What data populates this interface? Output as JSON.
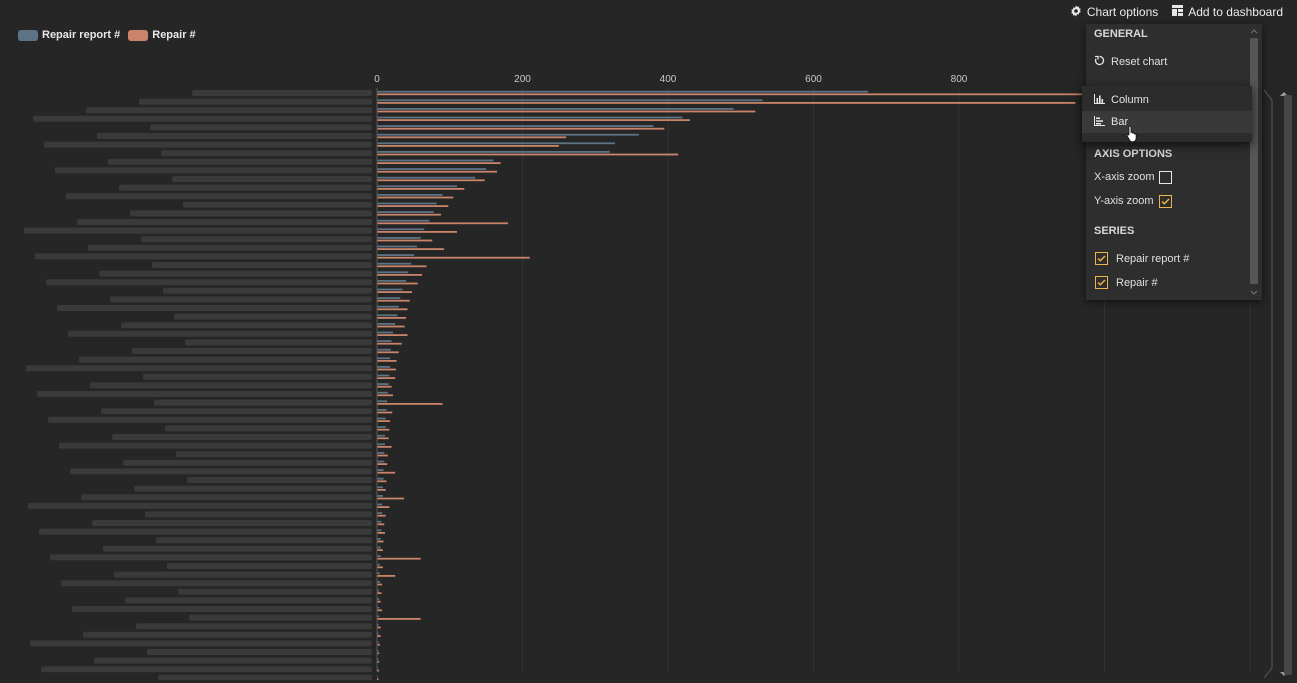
{
  "legend": {
    "items": [
      {
        "label": "Repair report #",
        "color": "#5f7387"
      },
      {
        "label": "Repair #",
        "color": "#c98469"
      }
    ]
  },
  "toolbar": {
    "chart_options_label": "Chart options",
    "add_to_dashboard_label": "Add to dashboard"
  },
  "menu": {
    "general_title": "GENERAL",
    "reset_label": "Reset chart",
    "chart_types": [
      {
        "label": "Column",
        "selected": false
      },
      {
        "label": "Bar",
        "selected": true
      }
    ],
    "axis_title": "AXIS OPTIONS",
    "x_zoom_label": "X-axis zoom",
    "x_zoom_checked": false,
    "y_zoom_label": "Y-axis zoom",
    "y_zoom_checked": true,
    "series_title": "SERIES",
    "series": [
      {
        "label": "Repair report #",
        "checked": true
      },
      {
        "label": "Repair #",
        "checked": true
      }
    ]
  },
  "colors": {
    "report": "#5f7387",
    "repair": "#c98469",
    "accent": "#e8b84a"
  },
  "chart_data": {
    "type": "bar",
    "orientation": "horizontal",
    "x_ticks": [
      0,
      200,
      400,
      600,
      800
    ],
    "xlim": [
      0,
      1200
    ],
    "grid": true,
    "category_labels_obscured": true,
    "series": [
      {
        "name": "Repair report #",
        "values": [
          675,
          530,
          490,
          420,
          380,
          360,
          327,
          320,
          160,
          150,
          135,
          110,
          90,
          82,
          78,
          72,
          65,
          60,
          55,
          51,
          47,
          43,
          40,
          35,
          32,
          30,
          28,
          25,
          22,
          20,
          19,
          18,
          18,
          17,
          16,
          15,
          14,
          13,
          12,
          12,
          11,
          11,
          10,
          10,
          9,
          9,
          8,
          8,
          7,
          7,
          6,
          6,
          5,
          5,
          5,
          4,
          4,
          4,
          3,
          3,
          3,
          3,
          2,
          2,
          2,
          2,
          2,
          1,
          1,
          1,
          1,
          1
        ]
      },
      {
        "name": "Repair #",
        "values": [
          1020,
          960,
          520,
          430,
          395,
          260,
          250,
          414,
          170,
          165,
          148,
          120,
          105,
          98,
          88,
          180,
          110,
          76,
          92,
          210,
          68,
          62,
          56,
          48,
          45,
          42,
          40,
          38,
          42,
          34,
          30,
          27,
          26,
          25,
          20,
          22,
          90,
          21,
          18,
          17,
          16,
          20,
          15,
          14,
          25,
          13,
          12,
          37,
          17,
          12,
          10,
          11,
          9,
          8,
          60,
          8,
          25,
          7,
          6,
          5,
          7,
          60,
          5,
          5,
          4,
          3,
          3,
          3,
          2,
          2,
          1,
          1
        ]
      }
    ]
  }
}
